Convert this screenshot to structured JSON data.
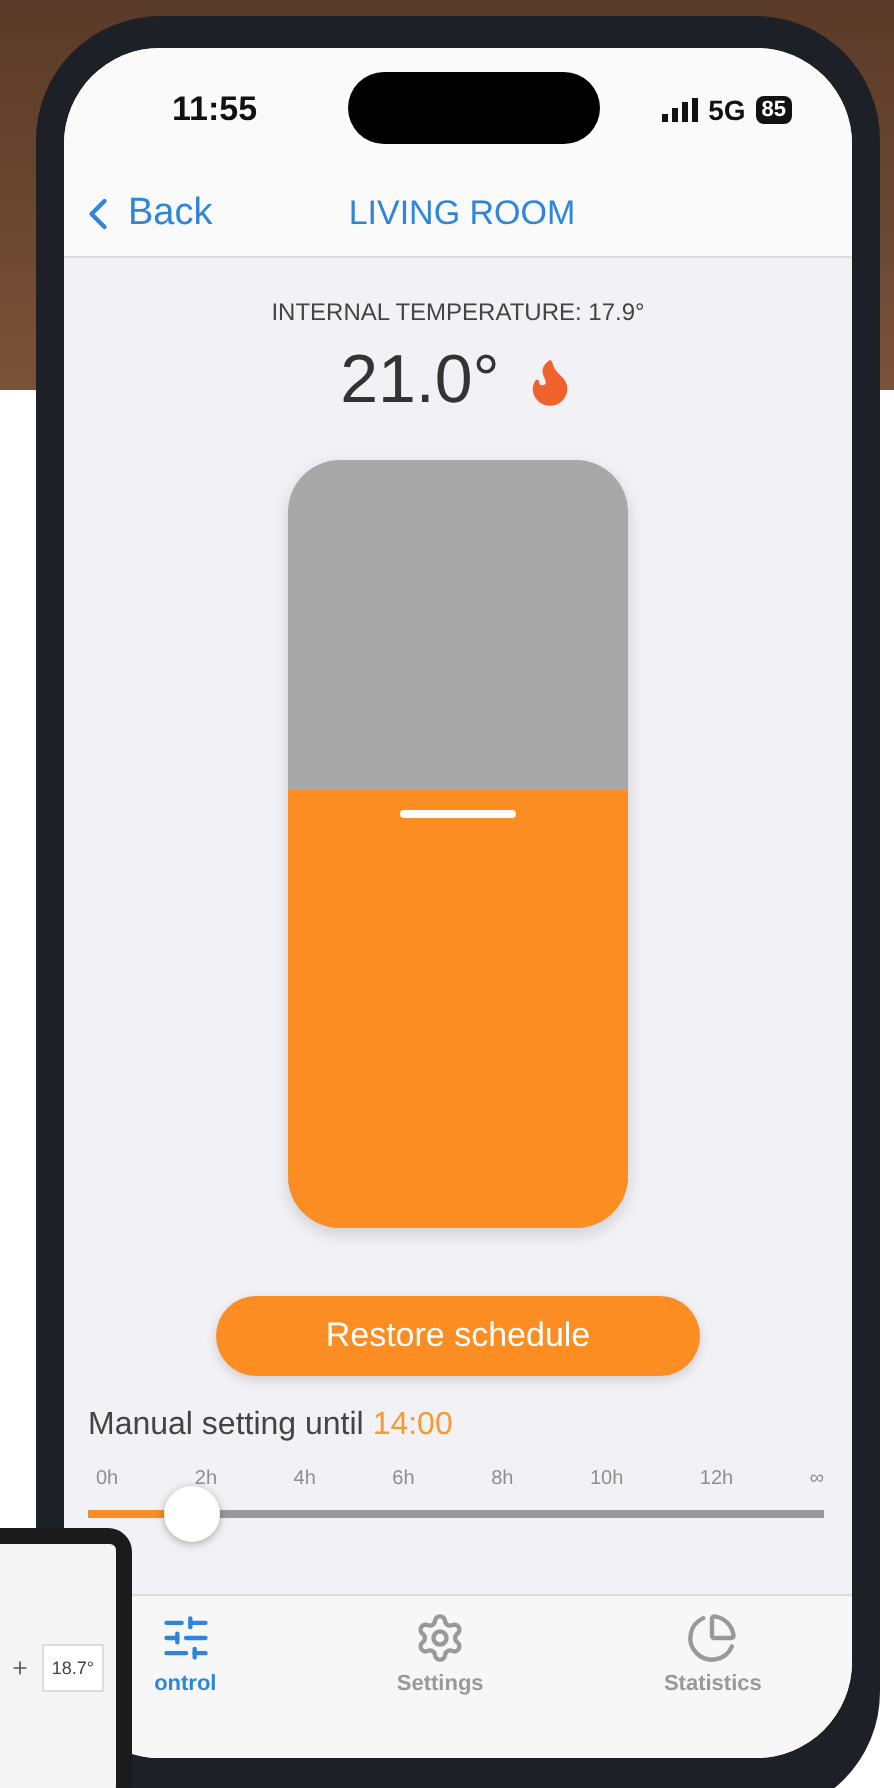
{
  "status_bar": {
    "time": "11:55",
    "network": "5G",
    "battery": "85"
  },
  "nav": {
    "back": "Back",
    "title": "LIVING ROOM"
  },
  "internal_temperature": "INTERNAL TEMPERATURE: 17.9°",
  "setpoint": {
    "value": "21.0°",
    "heating": true,
    "level": 0.57
  },
  "restore_button": "Restore schedule",
  "manual": {
    "label": "Manual setting until",
    "time": "14:00"
  },
  "duration_slider": {
    "ticks": [
      "0h",
      "2h",
      "4h",
      "6h",
      "8h",
      "10h",
      "12h",
      "∞"
    ],
    "level": 0.14
  },
  "tabs": [
    {
      "label": "ontrol",
      "selected": true
    },
    {
      "label": "Settings",
      "selected": false
    },
    {
      "label": "Statistics",
      "selected": false
    }
  ],
  "tablet": {
    "reading": "18.7°"
  }
}
